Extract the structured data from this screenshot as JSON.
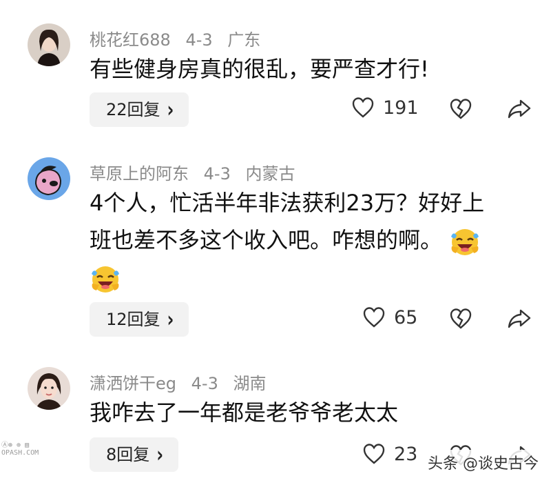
{
  "comments": [
    {
      "username": "桃花红688",
      "date": "4-3",
      "location": "广东",
      "text": "有些健身房真的很乱，要严查才行!",
      "reply_label": "22回复",
      "likes": "191",
      "avatar": "woman-portrait"
    },
    {
      "username": "草原上的阿东",
      "date": "4-3",
      "location": "内蒙古",
      "text_line1": "4个人，忙活半年非法获利23万？好好上",
      "text_line2": "班也差不多这个收入吧。咋想的啊。",
      "reply_label": "12回复",
      "likes": "65",
      "avatar": "cartoon-dog",
      "emoji": "laughing-crying-emoji"
    },
    {
      "username": "潇洒饼干eg",
      "date": "4-3",
      "location": "湖南",
      "text": "我咋去了一年都是老爷爷老太太",
      "reply_label": "8回复",
      "likes": "23",
      "avatar": "woman-portrait"
    }
  ],
  "watermark": "头条 @谈史古今",
  "watermark_left_line1": "Ⓐ⊛ ⊕ ▤",
  "watermark_left_line2": "OPASH.COM",
  "colors": {
    "meta": "#8a8a8a",
    "reply_bg": "#f2f2f2",
    "text": "#111111",
    "avatar2_bg": "#6aa6e8"
  },
  "icons": [
    "heart-outline-icon",
    "broken-heart-icon",
    "share-arrow-icon",
    "chevron-right-icon"
  ]
}
